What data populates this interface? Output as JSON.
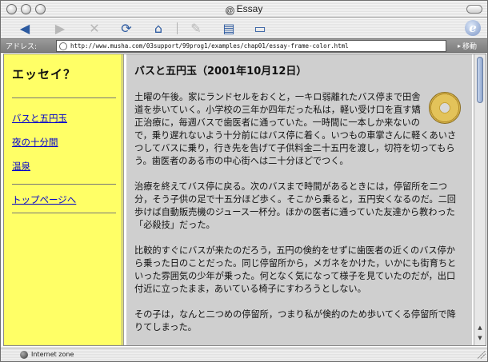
{
  "window": {
    "title": "Essay",
    "title_icon": "@"
  },
  "toolbar": {
    "buttons": [
      {
        "icon": "back-arrow-icon",
        "glyph": "◀"
      },
      {
        "icon": "forward-arrow-icon",
        "glyph": "▶"
      },
      {
        "icon": "stop-icon",
        "glyph": "✕"
      },
      {
        "icon": "refresh-icon",
        "glyph": "⟳"
      },
      {
        "icon": "home-icon",
        "glyph": "⌂"
      },
      {
        "icon": "autofill-icon",
        "glyph": "✎"
      },
      {
        "icon": "print-icon",
        "glyph": "▤"
      },
      {
        "icon": "mail-icon",
        "glyph": "▭"
      }
    ],
    "logo": "e"
  },
  "address": {
    "label": "アドレス:",
    "url": "http://www.musha.com/03support/99prog1/examples/chap01/essay-frame-color.html",
    "go_label": "移動",
    "go_glyph": "▸"
  },
  "sidebar": {
    "title": "エッセイ？",
    "links": [
      "バスと五円玉",
      "夜の十分間",
      "温泉"
    ],
    "top_link": "トップページへ"
  },
  "essay": {
    "title": "バスと五円玉（2001年10月12日）",
    "paragraphs": [
      "土曜の午後。家にランドセルをおくと，一キロ弱離れたバス停まで田舎道を歩いていく。小学校の三年か四年だった私は，軽い受け口を直す矯正治療に，毎週バスで歯医者に通っていた。一時間に一本しか来ないので，乗り遅れないよう十分前にはバス停に着く。いつもの車掌さんに軽くあいさつしてバスに乗り，行き先を告げて子供料金二十五円を渡し，切符を切ってもらう。歯医者のある市の中心街へは二十分ほどでつく。",
      "治療を終えてバス停に戻る。次のバスまで時間があるときには，停留所を二つ分，そう子供の足で十五分ほど歩く。そこから乗ると，五円安くなるのだ。二回歩けば自動販売機のジュース一杯分。ほかの医者に通っていた友達から教わった「必殺技」だった。",
      "比較的すぐにバスが来たのだろう，五円の倹約をせずに歯医者の近くのバス停から乗った日のことだった。同じ停留所から，メガネをかけた，いかにも街育ちといった雰囲気の少年が乗った。何となく気になって様子を見ていたのだが，出口付近に立ったまま，あいている椅子にすわろうとしない。",
      "その子は，なんと二つめの停留所，つまり私が倹約のため歩いてくる停留所で降りてしまった。"
    ]
  },
  "status": {
    "zone": "Internet zone"
  }
}
